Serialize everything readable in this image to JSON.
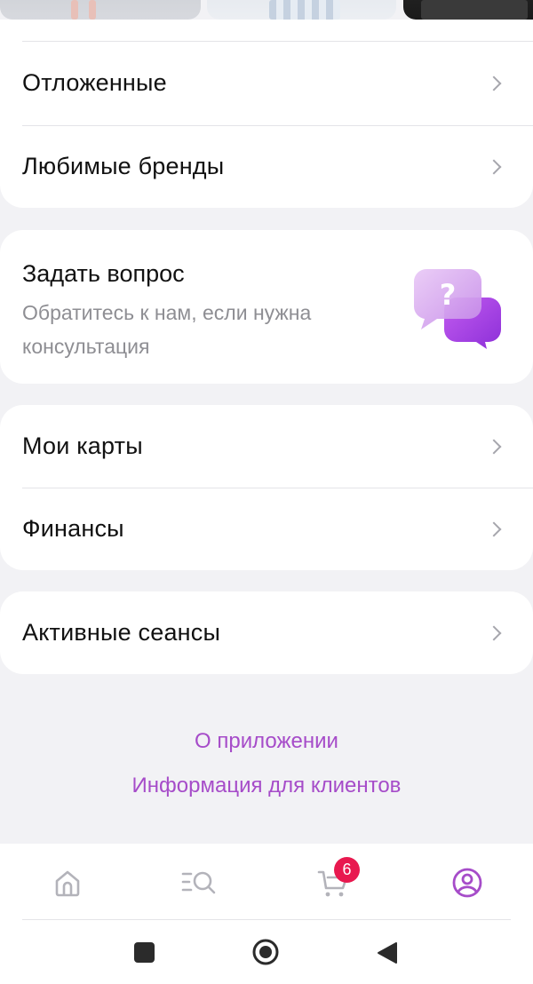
{
  "menu_top": {
    "items": [
      {
        "label": "Отложенные"
      },
      {
        "label": "Любимые бренды"
      }
    ]
  },
  "ask": {
    "title": "Задать вопрос",
    "subtitle": "Обратитесь к нам, если нужна консультация",
    "icon": "question-chat-icon"
  },
  "menu_finance": {
    "items": [
      {
        "label": "Мои карты"
      },
      {
        "label": "Финансы"
      }
    ]
  },
  "menu_sessions": {
    "items": [
      {
        "label": "Активные сеансы"
      }
    ]
  },
  "links": {
    "about": "О приложении",
    "clients_info": "Информация для клиентов"
  },
  "tabbar": {
    "items": [
      {
        "icon": "home-icon"
      },
      {
        "icon": "catalog-search-icon"
      },
      {
        "icon": "cart-icon",
        "badge": "6"
      },
      {
        "icon": "profile-icon",
        "active": true
      }
    ]
  },
  "colors": {
    "accent": "#a64cc9",
    "badge": "#e8194f",
    "muted_text": "#8e8e93"
  }
}
